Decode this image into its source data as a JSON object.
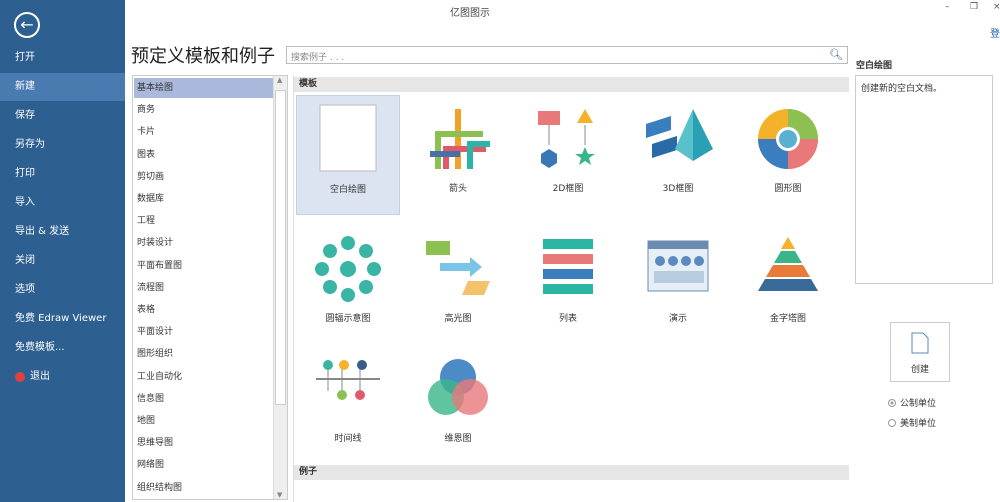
{
  "window": {
    "title": "亿图图示",
    "minimize": "–",
    "restore": "❐",
    "close": "×",
    "login": "登"
  },
  "sidebar": {
    "items": [
      {
        "label": "打开"
      },
      {
        "label": "新建"
      },
      {
        "label": "保存"
      },
      {
        "label": "另存为"
      },
      {
        "label": "打印"
      },
      {
        "label": "导入"
      },
      {
        "label": "导出 & 发送"
      },
      {
        "label": "关闭"
      },
      {
        "label": "选项"
      },
      {
        "label": "免费 Edraw Viewer"
      },
      {
        "label": "免费模板..."
      },
      {
        "label": "退出"
      }
    ],
    "selected": "新建"
  },
  "heading": "预定义模板和例子",
  "search": {
    "placeholder": "搜索例子 . . ."
  },
  "categories": [
    "基本绘图",
    "商务",
    "卡片",
    "图表",
    "剪切画",
    "数据库",
    "工程",
    "时装设计",
    "平面布置图",
    "流程图",
    "表格",
    "平面设计",
    "图形组织",
    "工业自动化",
    "信息图",
    "地图",
    "思维导图",
    "网络图",
    "组织结构图"
  ],
  "main": {
    "templates_header": "模板",
    "examples_header": "例子",
    "templates": [
      {
        "label": "空白绘图",
        "icon": "blank-page-icon"
      },
      {
        "label": "箭头",
        "icon": "arrows-icon"
      },
      {
        "label": "2D框图",
        "icon": "2d-block-icon"
      },
      {
        "label": "3D框图",
        "icon": "3d-block-icon"
      },
      {
        "label": "圆形图",
        "icon": "circle-chart-icon"
      },
      {
        "label": "圆辐示意图",
        "icon": "radial-icon"
      },
      {
        "label": "高光图",
        "icon": "highlight-icon"
      },
      {
        "label": "列表",
        "icon": "list-icon"
      },
      {
        "label": "演示",
        "icon": "presentation-icon"
      },
      {
        "label": "金字塔图",
        "icon": "pyramid-icon"
      },
      {
        "label": "时间线",
        "icon": "timeline-icon"
      },
      {
        "label": "维恩图",
        "icon": "venn-icon"
      }
    ]
  },
  "right": {
    "title": "空白绘图",
    "description": "创建新的空白文档。",
    "create": "创建",
    "units": [
      {
        "label": "公制单位",
        "checked": true
      },
      {
        "label": "美制单位",
        "checked": false
      }
    ]
  }
}
